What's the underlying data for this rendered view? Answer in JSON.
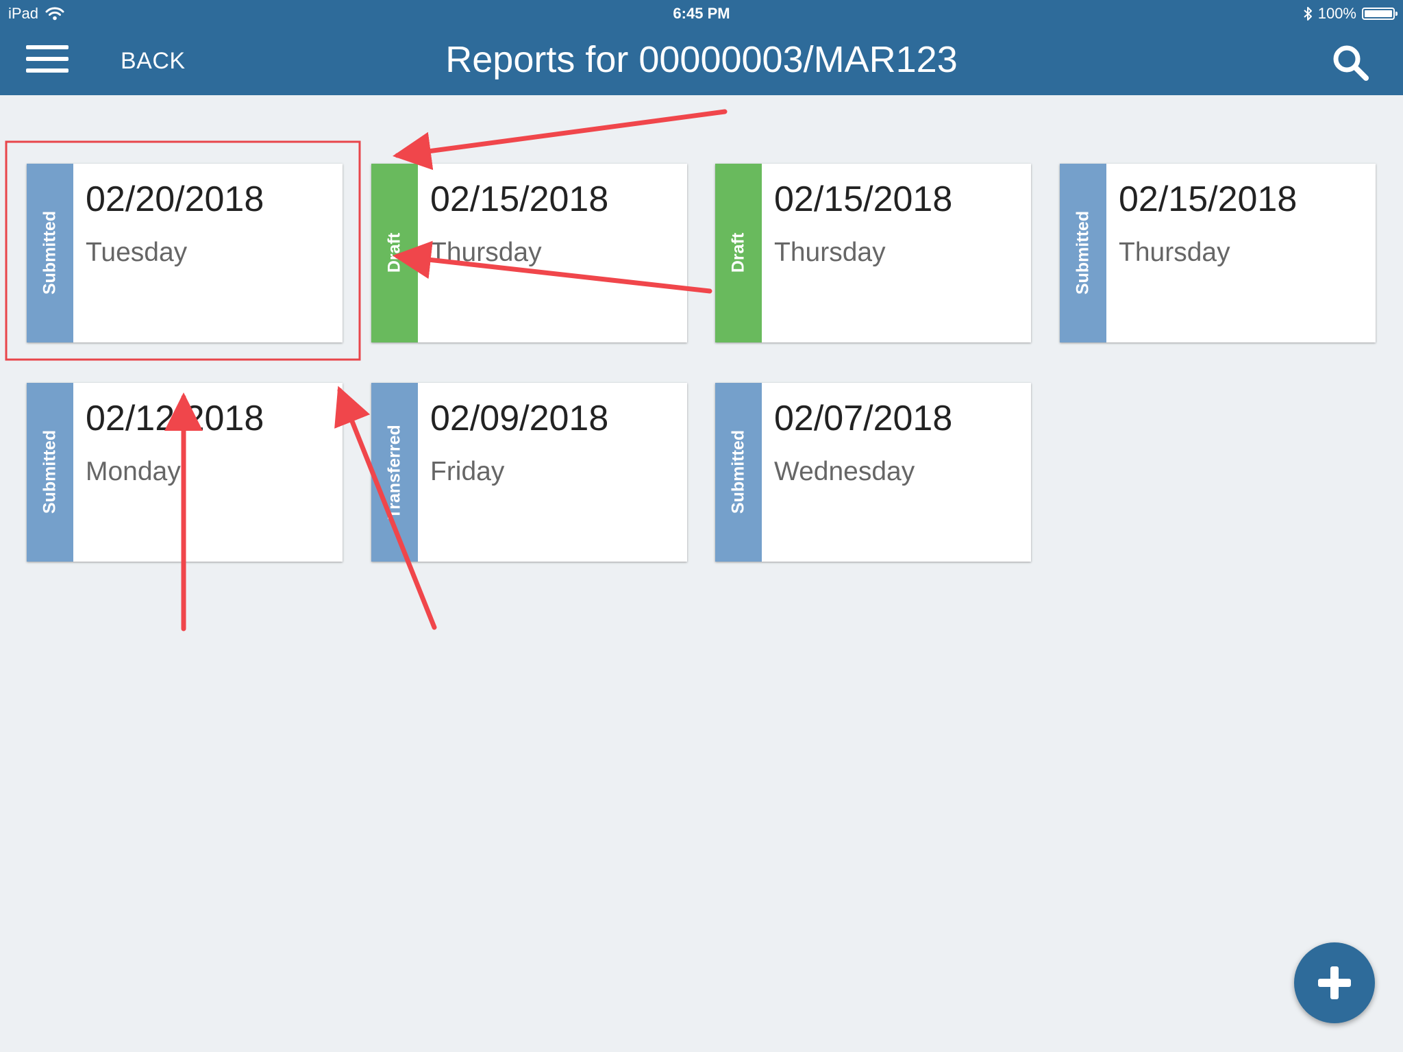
{
  "status_bar": {
    "device": "iPad",
    "time": "6:45 PM",
    "battery": "100%",
    "wifi_icon": "wifi-icon",
    "bluetooth_icon": "bluetooth-icon"
  },
  "header": {
    "back_label": "BACK",
    "title": "Reports for 00000003/MAR123",
    "menu_icon": "hamburger-menu-icon",
    "search_icon": "search-icon"
  },
  "reports": [
    {
      "status": "Submitted",
      "date": "02/20/2018",
      "day": "Tuesday",
      "color": "#75a0cb"
    },
    {
      "status": "Draft",
      "date": "02/15/2018",
      "day": "Thursday",
      "color": "#69ba5d"
    },
    {
      "status": "Draft",
      "date": "02/15/2018",
      "day": "Thursday",
      "color": "#69ba5d"
    },
    {
      "status": "Submitted",
      "date": "02/15/2018",
      "day": "Thursday",
      "color": "#75a0cb"
    },
    {
      "status": "Submitted",
      "date": "02/12/2018",
      "day": "Monday",
      "color": "#75a0cb"
    },
    {
      "status": "Transferred",
      "date": "02/09/2018",
      "day": "Friday",
      "color": "#75a0cb"
    },
    {
      "status": "Submitted",
      "date": "02/07/2018",
      "day": "Wednesday",
      "color": "#75a0cb"
    }
  ],
  "fab": {
    "icon": "plus-icon"
  },
  "colors": {
    "header": "#2e6b9a",
    "background": "#edf0f3",
    "annotation": "#f0464b"
  }
}
